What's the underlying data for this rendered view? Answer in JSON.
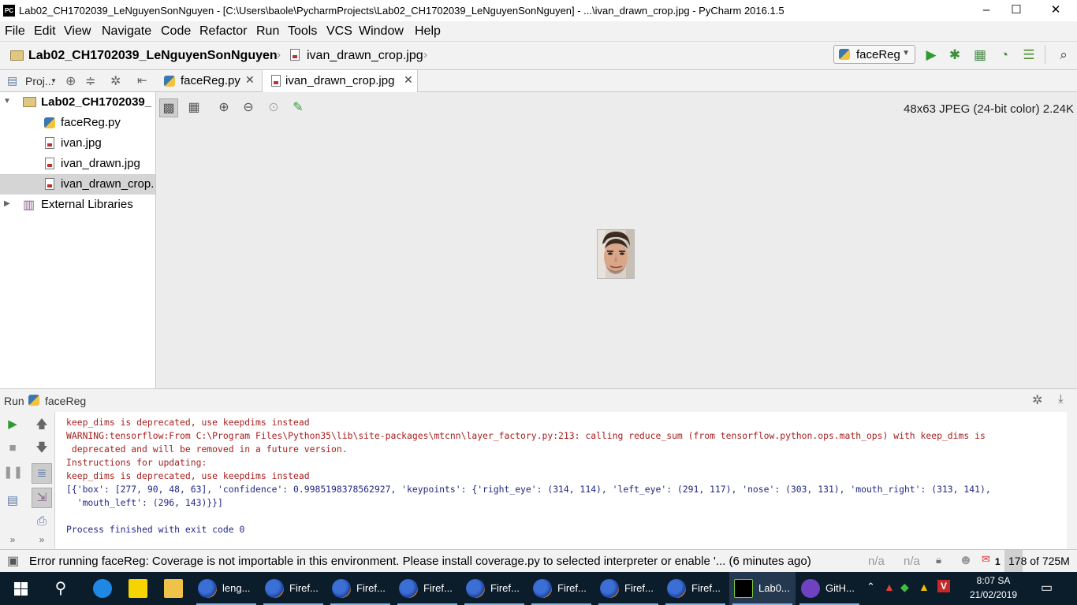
{
  "window": {
    "title": "Lab02_CH1702039_LeNguyenSonNguyen - [C:\\Users\\baole\\PycharmProjects\\Lab02_CH1702039_LeNguyenSonNguyen] - ...\\ivan_drawn_crop.jpg - PyCharm 2016.1.5",
    "app_badge": "PC",
    "buttons": {
      "minimize": "–",
      "maximize": "☐",
      "close": "✕"
    }
  },
  "menu": [
    "File",
    "Edit",
    "View",
    "Navigate",
    "Code",
    "Refactor",
    "Run",
    "Tools",
    "VCS",
    "Window",
    "Help"
  ],
  "navbar": {
    "breadcrumbs": [
      "Lab02_CH1702039_LeNguyenSonNguyen",
      "ivan_drawn_crop.jpg"
    ],
    "run_config": "faceReg"
  },
  "project_panel": {
    "label": "Proj...",
    "tree": [
      {
        "label": "Lab02_CH1702039_",
        "type": "folder",
        "expanded": true
      },
      {
        "label": "faceReg.py",
        "type": "python"
      },
      {
        "label": "ivan.jpg",
        "type": "image"
      },
      {
        "label": "ivan_drawn.jpg",
        "type": "image"
      },
      {
        "label": "ivan_drawn_crop.",
        "type": "image",
        "selected": true
      },
      {
        "label": "External Libraries",
        "type": "library"
      }
    ]
  },
  "editor": {
    "tabs": [
      {
        "label": "faceReg.py",
        "active": false
      },
      {
        "label": "ivan_drawn_crop.jpg",
        "active": true
      }
    ],
    "image_info": "48x63 JPEG (24-bit color) 2.24K"
  },
  "run_panel": {
    "label": "Run",
    "config": "faceReg",
    "console": [
      {
        "text": "keep_dims is deprecated, use keepdims instead",
        "kind": "err"
      },
      {
        "text": "WARNING:tensorflow:From C:\\Program Files\\Python35\\lib\\site-packages\\mtcnn\\layer_factory.py:213: calling reduce_sum (from tensorflow.python.ops.math_ops) with keep_dims is",
        "kind": "err"
      },
      {
        "text": " deprecated and will be removed in a future version.",
        "kind": "err"
      },
      {
        "text": "Instructions for updating:",
        "kind": "err"
      },
      {
        "text": "keep_dims is deprecated, use keepdims instead",
        "kind": "err"
      },
      {
        "text": "[{'box': [277, 90, 48, 63], 'confidence': 0.9985198378562927, 'keypoints': {'right_eye': (314, 114), 'left_eye': (291, 117), 'nose': (303, 131), 'mouth_right': (313, 141),",
        "kind": "out"
      },
      {
        "text": "  'mouth_left': (296, 143)}}]",
        "kind": "out"
      },
      {
        "text": "",
        "kind": "out"
      },
      {
        "text": "Process finished with exit code 0",
        "kind": "info"
      }
    ]
  },
  "status": {
    "message": "Error running faceReg: Coverage is not importable in this environment. Please install coverage.py to selected interpreter or enable '... (6 minutes ago)",
    "na1": "n/a",
    "na2": "n/a",
    "error_count": "1",
    "memory": "178 of 725M",
    "memory_used_fraction": 0.245
  },
  "taskbar": {
    "items": [
      {
        "label": "leng...",
        "icon": "firefox-icon"
      },
      {
        "label": "Firef...",
        "icon": "firefox-icon"
      },
      {
        "label": "Firef...",
        "icon": "firefox-icon"
      },
      {
        "label": "Firef...",
        "icon": "firefox-icon"
      },
      {
        "label": "Firef...",
        "icon": "firefox-icon"
      },
      {
        "label": "Firef...",
        "icon": "firefox-icon"
      },
      {
        "label": "Firef...",
        "icon": "firefox-icon"
      },
      {
        "label": "Firef...",
        "icon": "firefox-icon"
      },
      {
        "label": "Lab0...",
        "icon": "pycharm-icon"
      },
      {
        "label": "GitH...",
        "icon": "github-icon"
      }
    ],
    "time": "8:07 SA",
    "date": "21/02/2019"
  },
  "colors": {
    "console_error": "#a61f1f",
    "console_info": "#212884",
    "run_green": "#3c9a3c",
    "taskbar_bg": "#0b1c2b",
    "selection": "#d5d5d5"
  }
}
